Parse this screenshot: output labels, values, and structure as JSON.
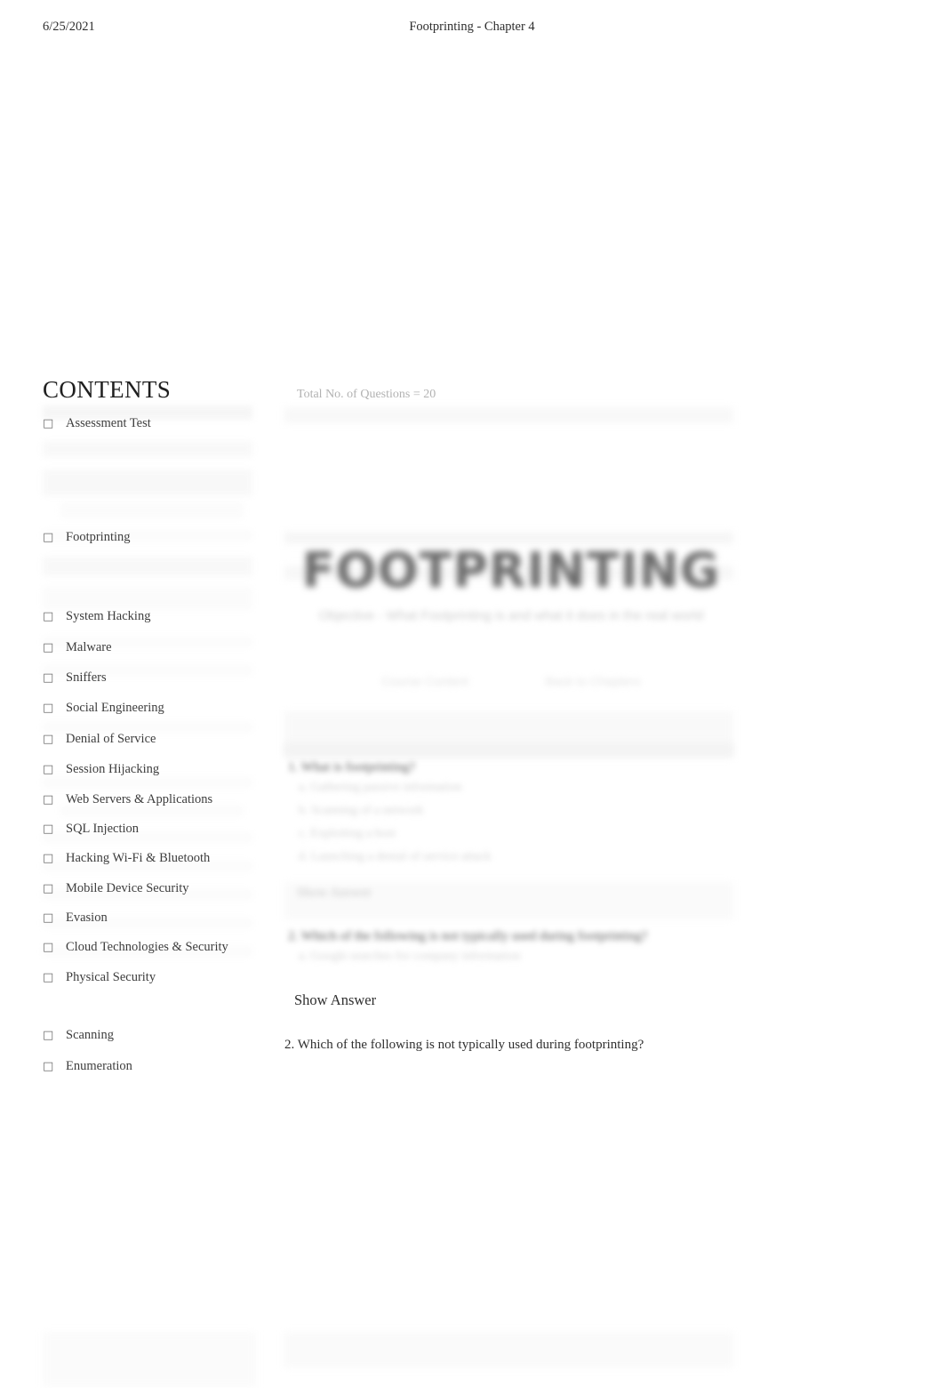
{
  "header": {
    "date": "6/25/2021",
    "title": "Footprinting - Chapter 4"
  },
  "sidebar": {
    "heading": "CONTENTS",
    "bullet_glyph": "□",
    "items": [
      {
        "label": "Assessment Test"
      },
      {
        "label": "Footprinting"
      },
      {
        "label": "System Hacking"
      },
      {
        "label": "Malware"
      },
      {
        "label": "Sniffers"
      },
      {
        "label": "Social Engineering"
      },
      {
        "label": "Denial of Service"
      },
      {
        "label": "Session Hijacking"
      },
      {
        "label": "Web Servers & Applications"
      },
      {
        "label": "SQL Injection"
      },
      {
        "label": "Hacking Wi-Fi & Bluetooth"
      },
      {
        "label": "Mobile Device Security"
      },
      {
        "label": "Evasion"
      },
      {
        "label": "Cloud Technologies & Security"
      },
      {
        "label": "Physical Security"
      },
      {
        "label": "Scanning"
      },
      {
        "label": "Enumeration"
      }
    ]
  },
  "content": {
    "total_questions": "Total No. of Questions = 20",
    "banner": {
      "title": "FOOTPRINTING",
      "subtitle": "Objective  -  What Footprinting is and what it does in the real world"
    },
    "pills": [
      {
        "label": "Course Content"
      },
      {
        "label": "Back to Chapters"
      }
    ],
    "question_1": {
      "prompt": "1. What is footprinting?",
      "options": [
        "a. Gathering passive information",
        "b. Scanning of a network",
        "c. Exploiting a host",
        "d. Launching a denial of service attack"
      ],
      "show_answer_blurred": "Show Answer"
    },
    "question_2": {
      "prompt": "2. Which of the following is not typically used during footprinting?",
      "options": [
        "a. Google searches for company information"
      ]
    },
    "show_answer_label": "Show Answer",
    "visible_question": "2. Which of the following is not typically used during footprinting?"
  }
}
